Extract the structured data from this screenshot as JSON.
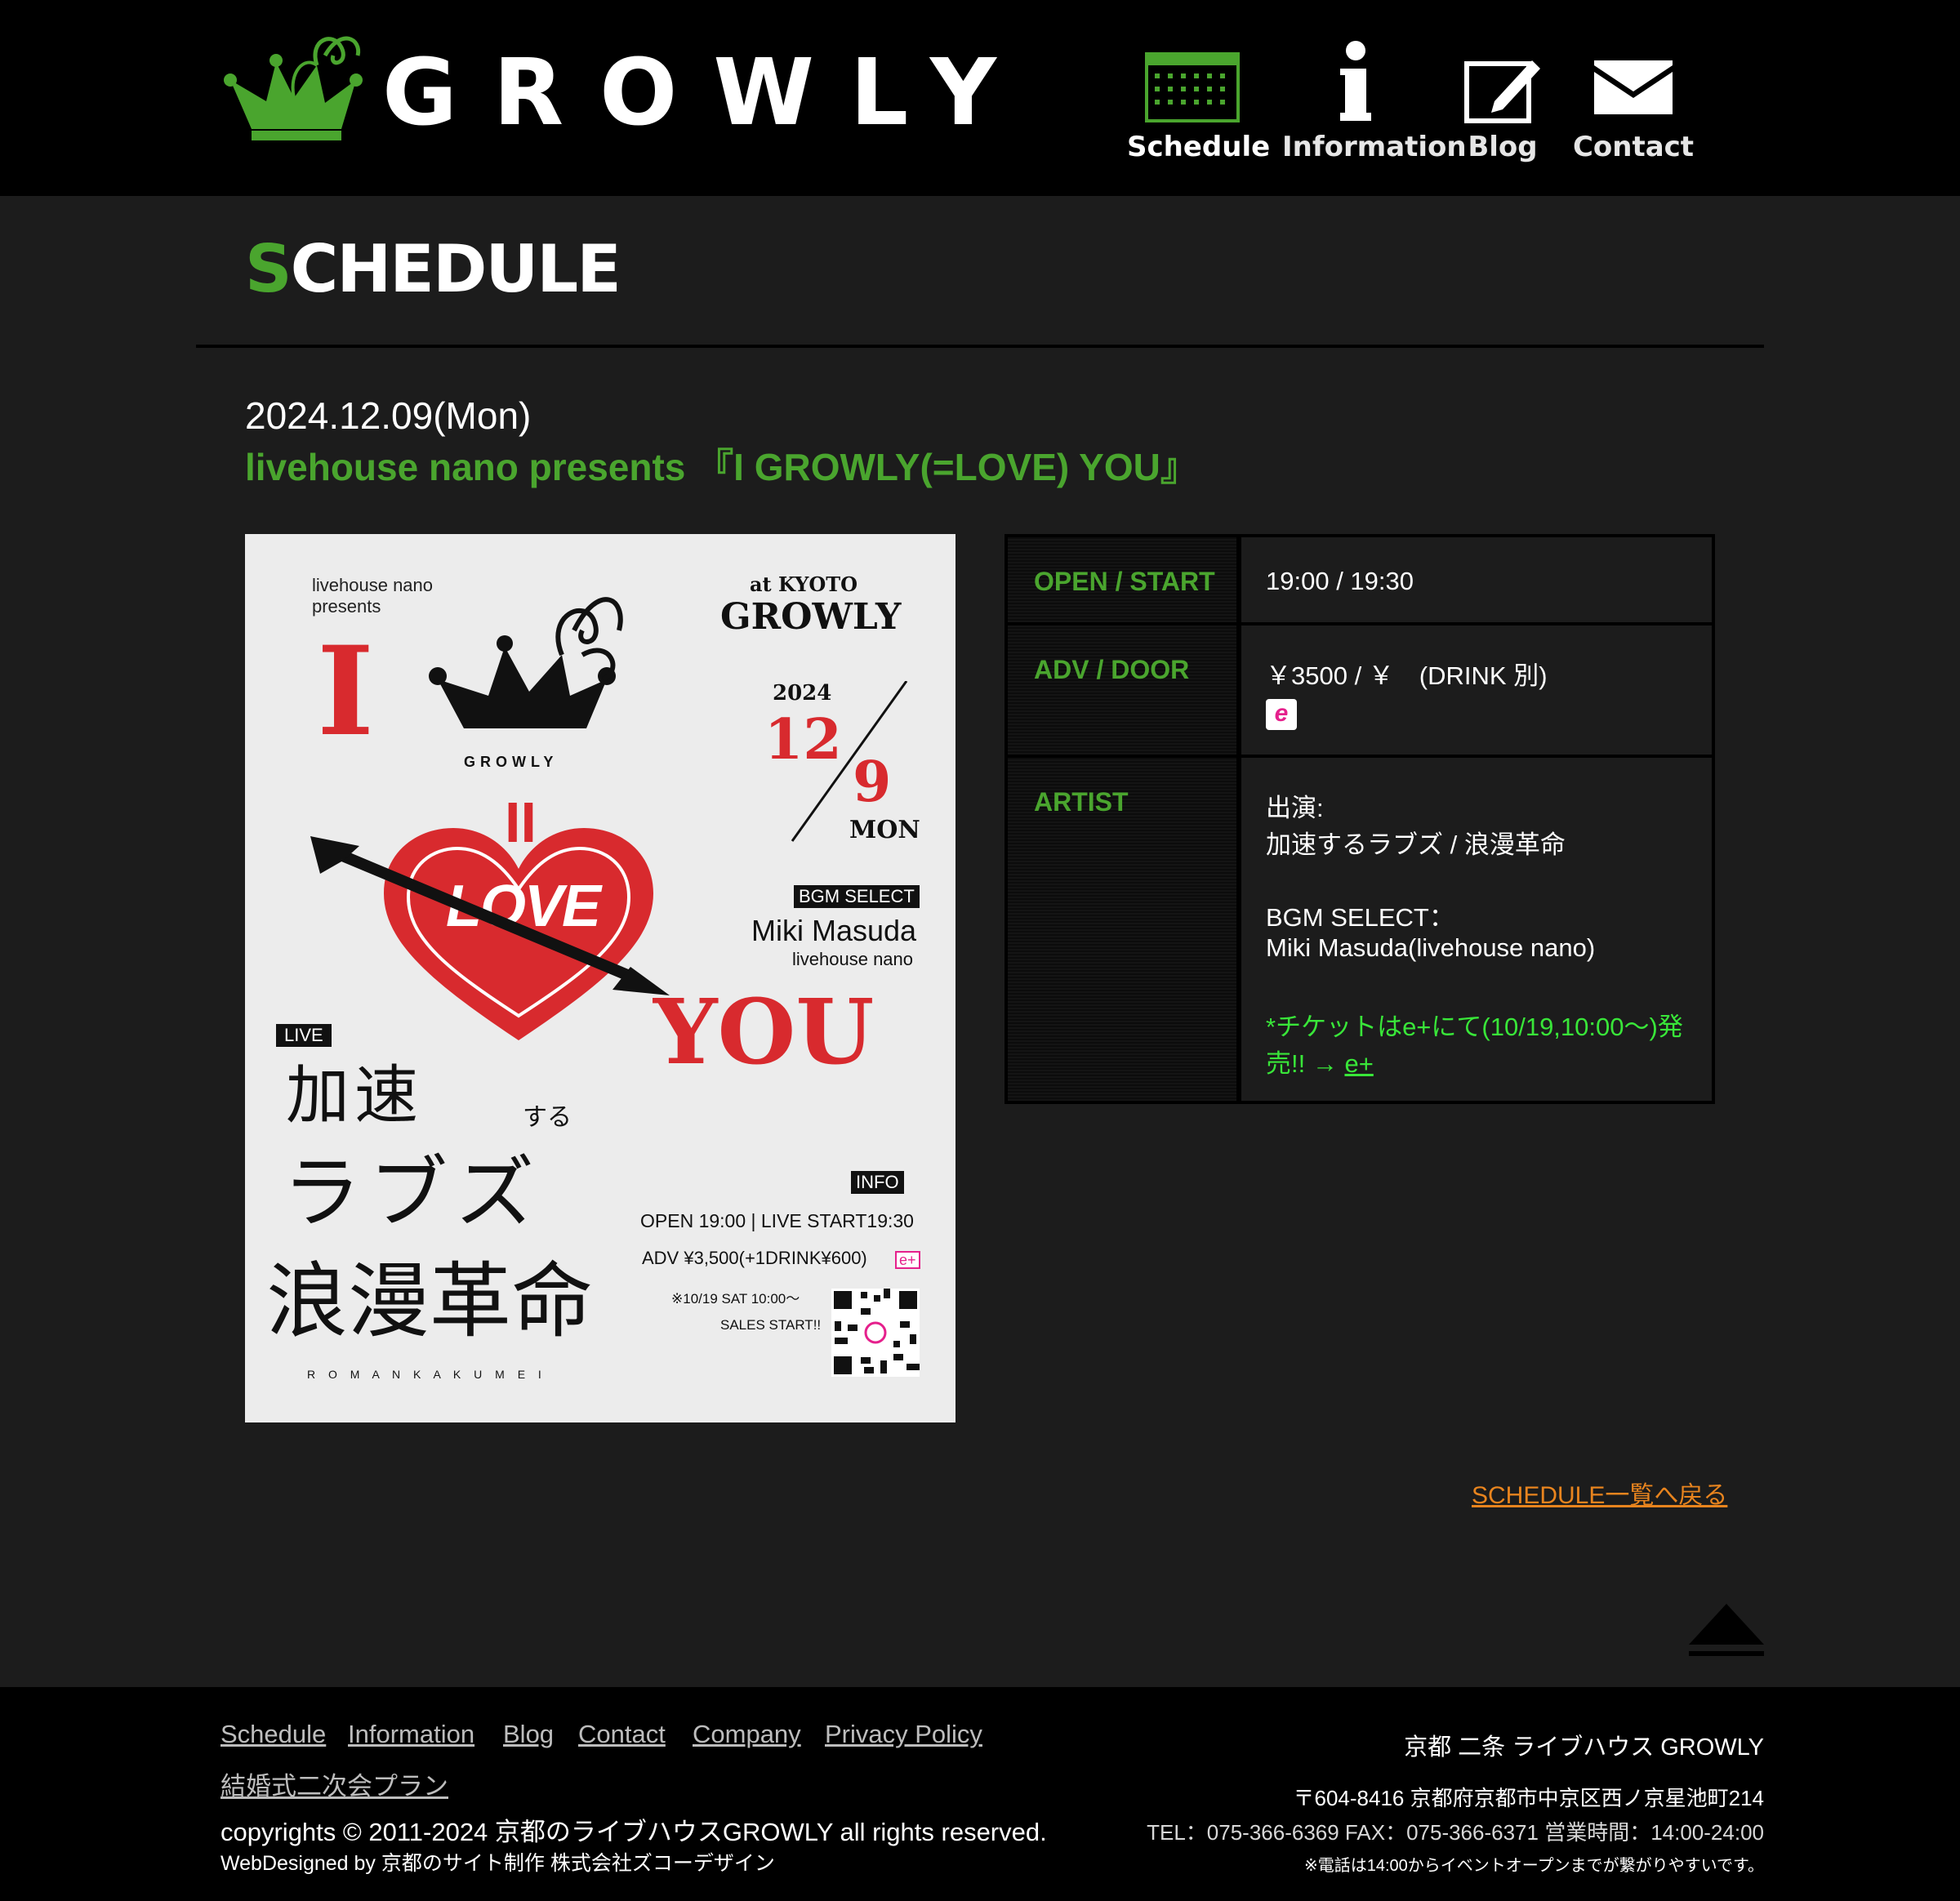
{
  "header": {
    "logo_text": "GROWLY",
    "nav": [
      {
        "label": "Schedule",
        "icon": "calendar-icon"
      },
      {
        "label": "Information",
        "icon": "info-icon"
      },
      {
        "label": "Blog",
        "icon": "edit-icon"
      },
      {
        "label": "Contact",
        "icon": "mail-icon"
      }
    ]
  },
  "page": {
    "section_title_first": "S",
    "section_title_rest": "CHEDULE",
    "event_date": "2024.12.09(Mon)",
    "event_title": "livehouse nano presents 『I GROWLY(=LOVE) YOU』"
  },
  "flyer": {
    "presenter_line1": "livehouse nano",
    "presenter_line2": "presents",
    "at_kyoto": "at KYOTO",
    "growly": "GROWLY",
    "crown_label": "GROWLY",
    "big_i": "I",
    "equals": "II",
    "love": "LOVE",
    "you": "YOU",
    "year": "2024",
    "month": "12",
    "day": "9",
    "weekday": "MON",
    "bgm_badge": "BGM SELECT",
    "bgm_name": "Miki Masuda",
    "bgm_from": "livehouse nano",
    "live_badge": "LIVE",
    "artist1_main": "加速",
    "artist1_suffix": "する",
    "artist1_line2": "ラブズ",
    "artist2": "浪漫革命",
    "artist2_roman": "R O M A N K A K U M E I",
    "info_badge": "INFO",
    "info_open": "OPEN 19:00 | LIVE START19:30",
    "info_adv": "ADV ¥3,500(+1DRINK¥600)",
    "info_eplus": "e+",
    "sales_line1": "※10/19 SAT 10:00〜",
    "sales_line2": "SALES START!!"
  },
  "info": {
    "open_label": "OPEN / START",
    "open_value": "19:00 / 19:30",
    "adv_label": "ADV / DOOR",
    "adv_value": "￥3500 / ￥　(DRINK 別)",
    "eplus_badge": "e",
    "artist_label": "ARTIST",
    "artist_lines": [
      "出演:",
      "加速するラブズ / 浪漫革命",
      "BGM SELECT：",
      "Miki Masuda(livehouse nano)"
    ],
    "ticket_line1": "*チケットはe+にて(10/19,10:00〜)発",
    "ticket_line2": "売!! → ",
    "ticket_link": "e+"
  },
  "back_link": "SCHEDULE一覧へ戻る",
  "footer": {
    "links": [
      "Schedule",
      "Information",
      "Blog",
      "Contact",
      "Company",
      "Privacy Policy"
    ],
    "wedding_link": "結婚式二次会プラン",
    "copyright": "copyrights © 2011-2024 京都のライブハウスGROWLY all rights reserved.",
    "designed": "WebDesigned by 京都のサイト制作 株式会社ズコーデザイン",
    "venue": "京都 二条 ライブハウス GROWLY",
    "address": "〒604-8416 京都府京都市中京区西ノ京星池町214",
    "contact_line": "TEL：075-366-6369 FAX：075-366-6371 営業時間：14:00-24:00",
    "note": "※電話は14:00からイベントオープンまでが繋がりやすいです。"
  }
}
